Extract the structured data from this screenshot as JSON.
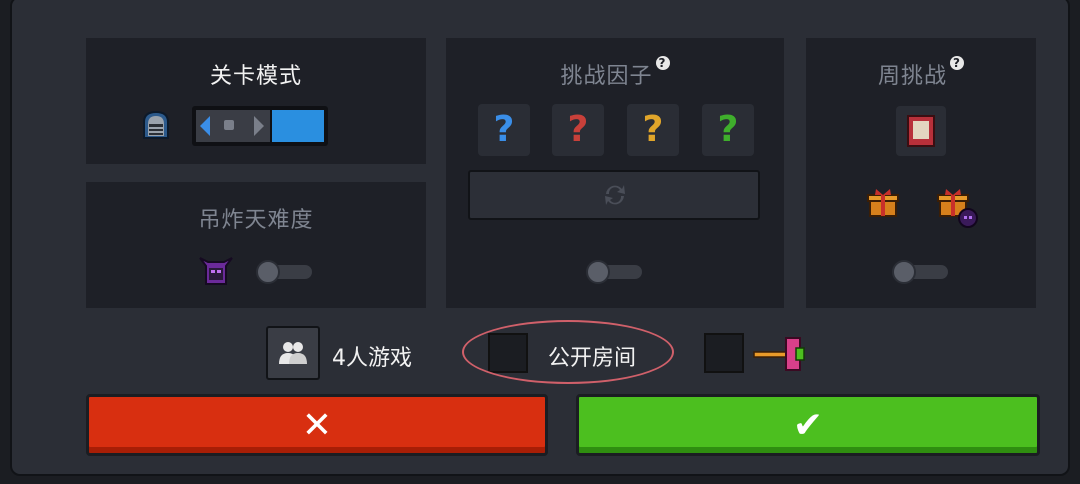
{
  "level_mode": {
    "title": "关卡模式"
  },
  "hardcore": {
    "title": "吊炸天难度",
    "toggle_on": false
  },
  "challenge_factors": {
    "title": "挑战因子",
    "help": "?",
    "slots": [
      {
        "label": "?",
        "color": "#3a8ee8"
      },
      {
        "label": "?",
        "color": "#c8403a"
      },
      {
        "label": "?",
        "color": "#e0a52a"
      },
      {
        "label": "?",
        "color": "#3fae2c"
      }
    ],
    "toggle_on": false
  },
  "weekly_challenge": {
    "title": "周挑战",
    "help": "?",
    "toggle_on": false
  },
  "options": {
    "four_player_label": "4人游戏",
    "public_room_label": "公开房间",
    "public_room_checked": false,
    "hammer_checked": false
  },
  "buttons": {
    "cancel_glyph": "✕",
    "confirm_glyph": "✔",
    "cancel_color": "#d82f10",
    "confirm_color": "#4cbf1f"
  }
}
